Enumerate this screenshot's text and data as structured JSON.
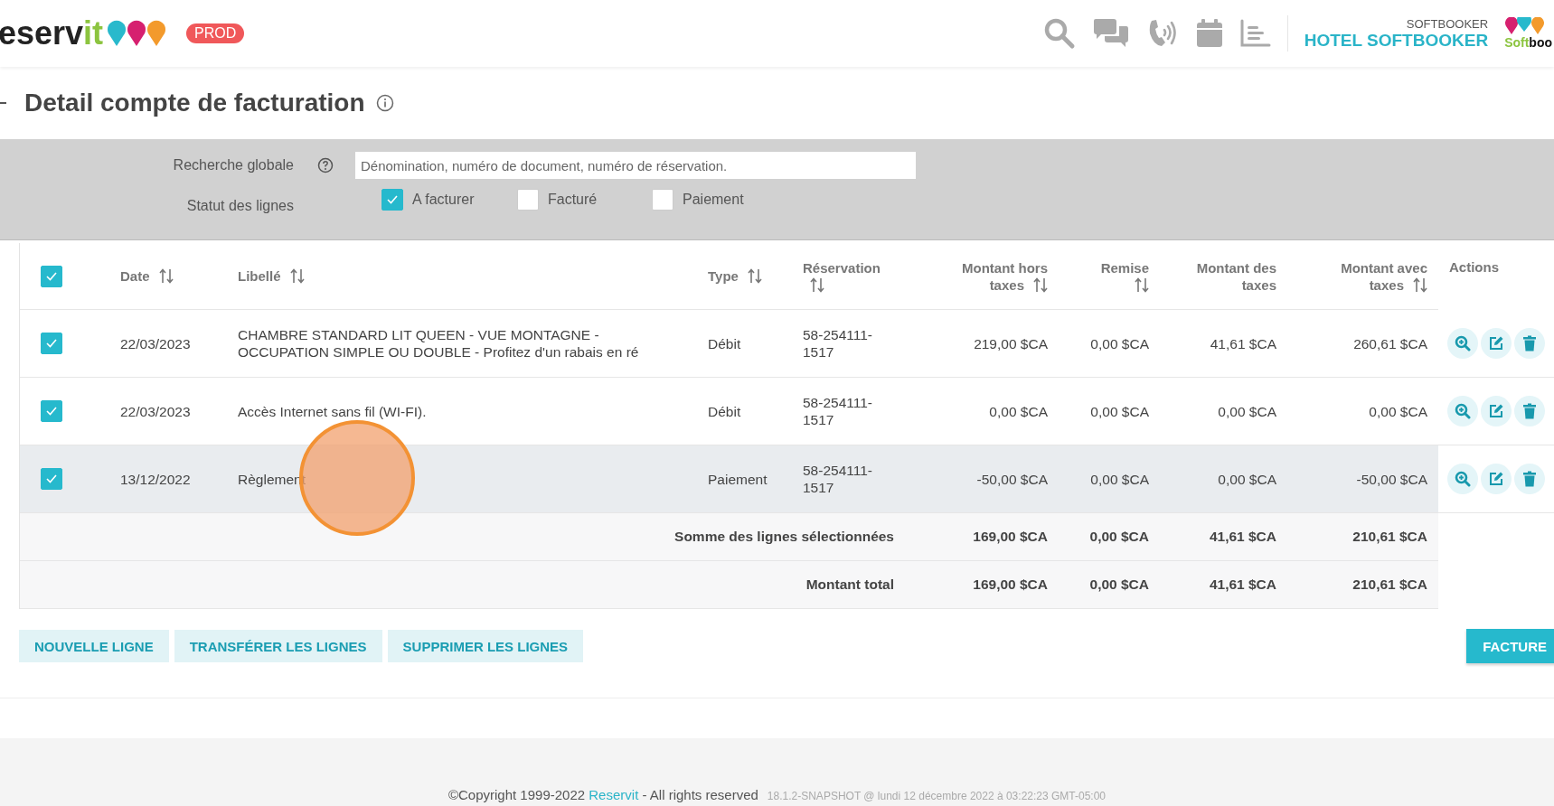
{
  "header": {
    "logo_text": "eserv",
    "logo_accent": "it",
    "env_badge": "PROD",
    "account_label": "SOFTBOOKER",
    "hotel_name": "HOTEL SOFTBOOKER",
    "partner_logo": "Softboo"
  },
  "page": {
    "title": "Detail compte de facturation"
  },
  "filters": {
    "search_label": "Recherche globale",
    "search": {
      "placeholder": "Dénomination, numéro de document, numéro de réservation."
    },
    "status_label": "Statut des lignes",
    "statuses": [
      {
        "label": "A facturer",
        "checked": true
      },
      {
        "label": "Facturé",
        "checked": false
      },
      {
        "label": "Paiement",
        "checked": false
      }
    ]
  },
  "table": {
    "all_checked": true,
    "columns": [
      {
        "label": "Date",
        "sortable": true
      },
      {
        "label": "Libellé",
        "sortable": true
      },
      {
        "label": "Type",
        "sortable": true
      },
      {
        "label": "Réservation",
        "sortable": true
      },
      {
        "label": "Montant hors taxes",
        "sortable": true
      },
      {
        "label": "Remise",
        "sortable": true
      },
      {
        "label": "Montant des taxes",
        "sortable": false
      },
      {
        "label": "Montant avec taxes",
        "sortable": true
      },
      {
        "label": "Actions",
        "sortable": false
      }
    ],
    "rows": [
      {
        "checked": true,
        "highlighted": false,
        "cells": [
          "22/03/2023",
          "CHAMBRE STANDARD LIT QUEEN - VUE MONTAGNE - OCCUPATION SIMPLE OU DOUBLE - Profitez d'un rabais en ré",
          "Débit",
          "58-254111-1517",
          "219,00 $CA",
          "0,00 $CA",
          "41,61 $CA",
          "260,61 $CA"
        ]
      },
      {
        "checked": true,
        "highlighted": false,
        "cells": [
          "22/03/2023",
          "Accès Internet sans fil (WI-FI).",
          "Débit",
          "58-254111-1517",
          "0,00 $CA",
          "0,00 $CA",
          "0,00 $CA",
          "0,00 $CA"
        ]
      },
      {
        "checked": true,
        "highlighted": true,
        "cells": [
          "13/12/2022",
          "Règlement",
          "Paiement",
          "58-254111-1517",
          "-50,00 $CA",
          "0,00 $CA",
          "0,00 $CA",
          "-50,00 $CA"
        ]
      }
    ],
    "totals": [
      {
        "label": "Somme des lignes sélectionnées",
        "values": [
          "169,00 $CA",
          "0,00 $CA",
          "41,61 $CA",
          "210,61 $CA"
        ]
      },
      {
        "label": "Montant total",
        "values": [
          "169,00 $CA",
          "0,00 $CA",
          "41,61 $CA",
          "210,61 $CA"
        ]
      }
    ]
  },
  "buttons": [
    {
      "label": "NOUVELLE LIGNE"
    },
    {
      "label": "TRANSFÉRER LES LIGNES"
    },
    {
      "label": "SUPPRIMER LES LIGNES"
    }
  ],
  "primary_button": "FACTURE",
  "footer": {
    "copyright": "©Copyright 1999-2022 ",
    "link": "Reservit",
    "rights": " - All rights reserved",
    "version": "18.1.2-SNAPSHOT @ lundi 12 décembre 2022 à 03:22:23 GMT-05:00"
  }
}
